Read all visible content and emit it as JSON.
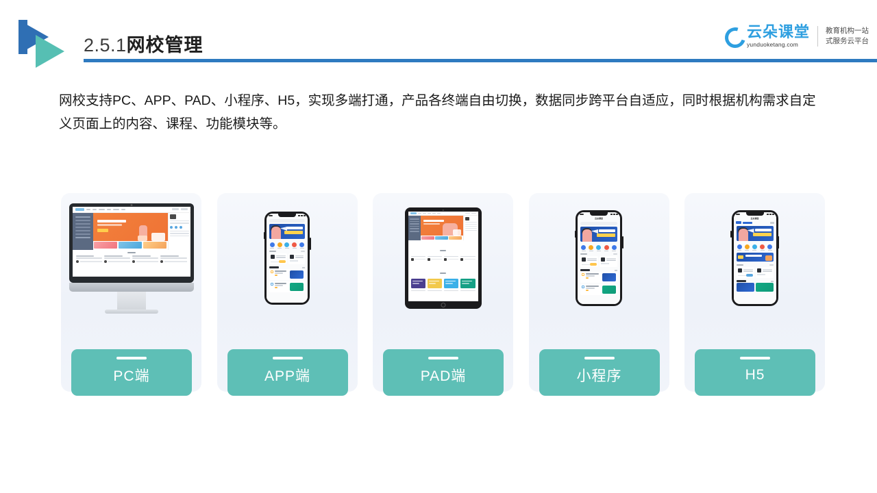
{
  "header": {
    "title_number": "2.5.1",
    "title_text": "网校管理",
    "rule_color": "#2e7ac0",
    "logo_colors": {
      "blue": "#2f6fb4",
      "teal": "#56bfb3"
    }
  },
  "brand": {
    "name_cn": "云朵课堂",
    "name_en": "yunduoketang.com",
    "tagline_line1": "教育机构一站",
    "tagline_line2": "式服务云平台",
    "color": "#2e9fe0"
  },
  "body": {
    "paragraph": "网校支持PC、APP、PAD、小程序、H5，实现多端打通，产品各终端自由切换，数据同步跨平台自适应，同时根据机构需求自定义页面上的内容、课程、功能模块等。"
  },
  "cards": [
    {
      "label": "PC端",
      "device": "desktop-monitor",
      "accent": "#5ebfb6"
    },
    {
      "label": "APP端",
      "device": "smartphone",
      "accent": "#5ebfb6"
    },
    {
      "label": "PAD端",
      "device": "tablet",
      "accent": "#5ebfb6"
    },
    {
      "label": "小程序",
      "device": "smartphone",
      "accent": "#5ebfb6"
    },
    {
      "label": "H5",
      "device": "smartphone",
      "accent": "#5ebfb6"
    }
  ],
  "theme": {
    "card_background": "#f1f4fa",
    "accent_teal": "#5ebfb6",
    "page_background": "#ffffff",
    "text_color": "#1a1a1a"
  }
}
